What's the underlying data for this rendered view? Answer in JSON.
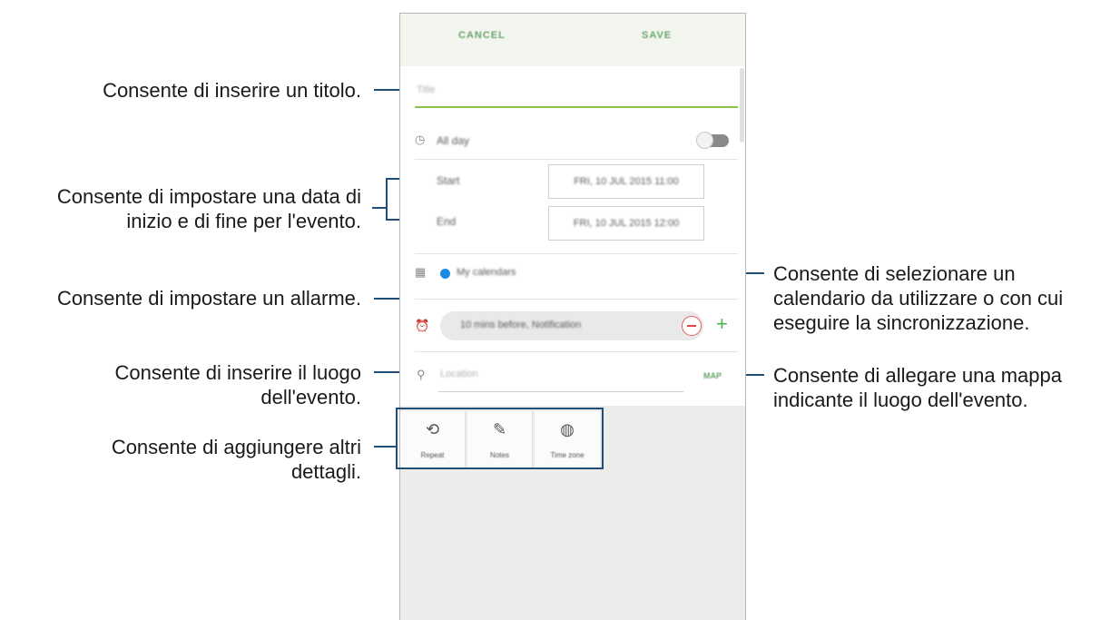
{
  "annotations": {
    "title": "Consente di inserire un titolo.",
    "dates": [
      "Consente di impostare una data di",
      "inizio e di fine per l'evento."
    ],
    "alarm": "Consente di impostare un allarme.",
    "location": [
      "Consente di inserire il luogo",
      "dell'evento."
    ],
    "details": [
      "Consente di aggiungere altri",
      "dettagli."
    ],
    "calendar": [
      "Consente di selezionare un",
      "calendario da utilizzare o con cui",
      "eseguire la sincronizzazione."
    ],
    "map": [
      "Consente di allegare una mappa",
      "indicante il luogo dell'evento."
    ]
  },
  "app": {
    "cancel_label": "CANCEL",
    "save_label": "SAVE",
    "title_placeholder": "Title",
    "allday_label": "All day",
    "start_label": "Start",
    "end_label": "End",
    "start_value": "FRI, 10 JUL 2015   11:00",
    "end_value": "FRI, 10 JUL 2015   12:00",
    "calendar_name": "My calendars",
    "reminder_value": "10 mins before, Notification",
    "location_placeholder": "Location",
    "map_label": "MAP",
    "tiles": [
      {
        "label": "Repeat",
        "icon": "repeat-icon"
      },
      {
        "label": "Notes",
        "icon": "notes-icon"
      },
      {
        "label": "Time zone",
        "icon": "time-zone-icon"
      }
    ]
  },
  "colors": {
    "annotation_line": "#1f4e79",
    "accent_green": "#8bc34a",
    "calendar_dot": "#1e88e5"
  }
}
